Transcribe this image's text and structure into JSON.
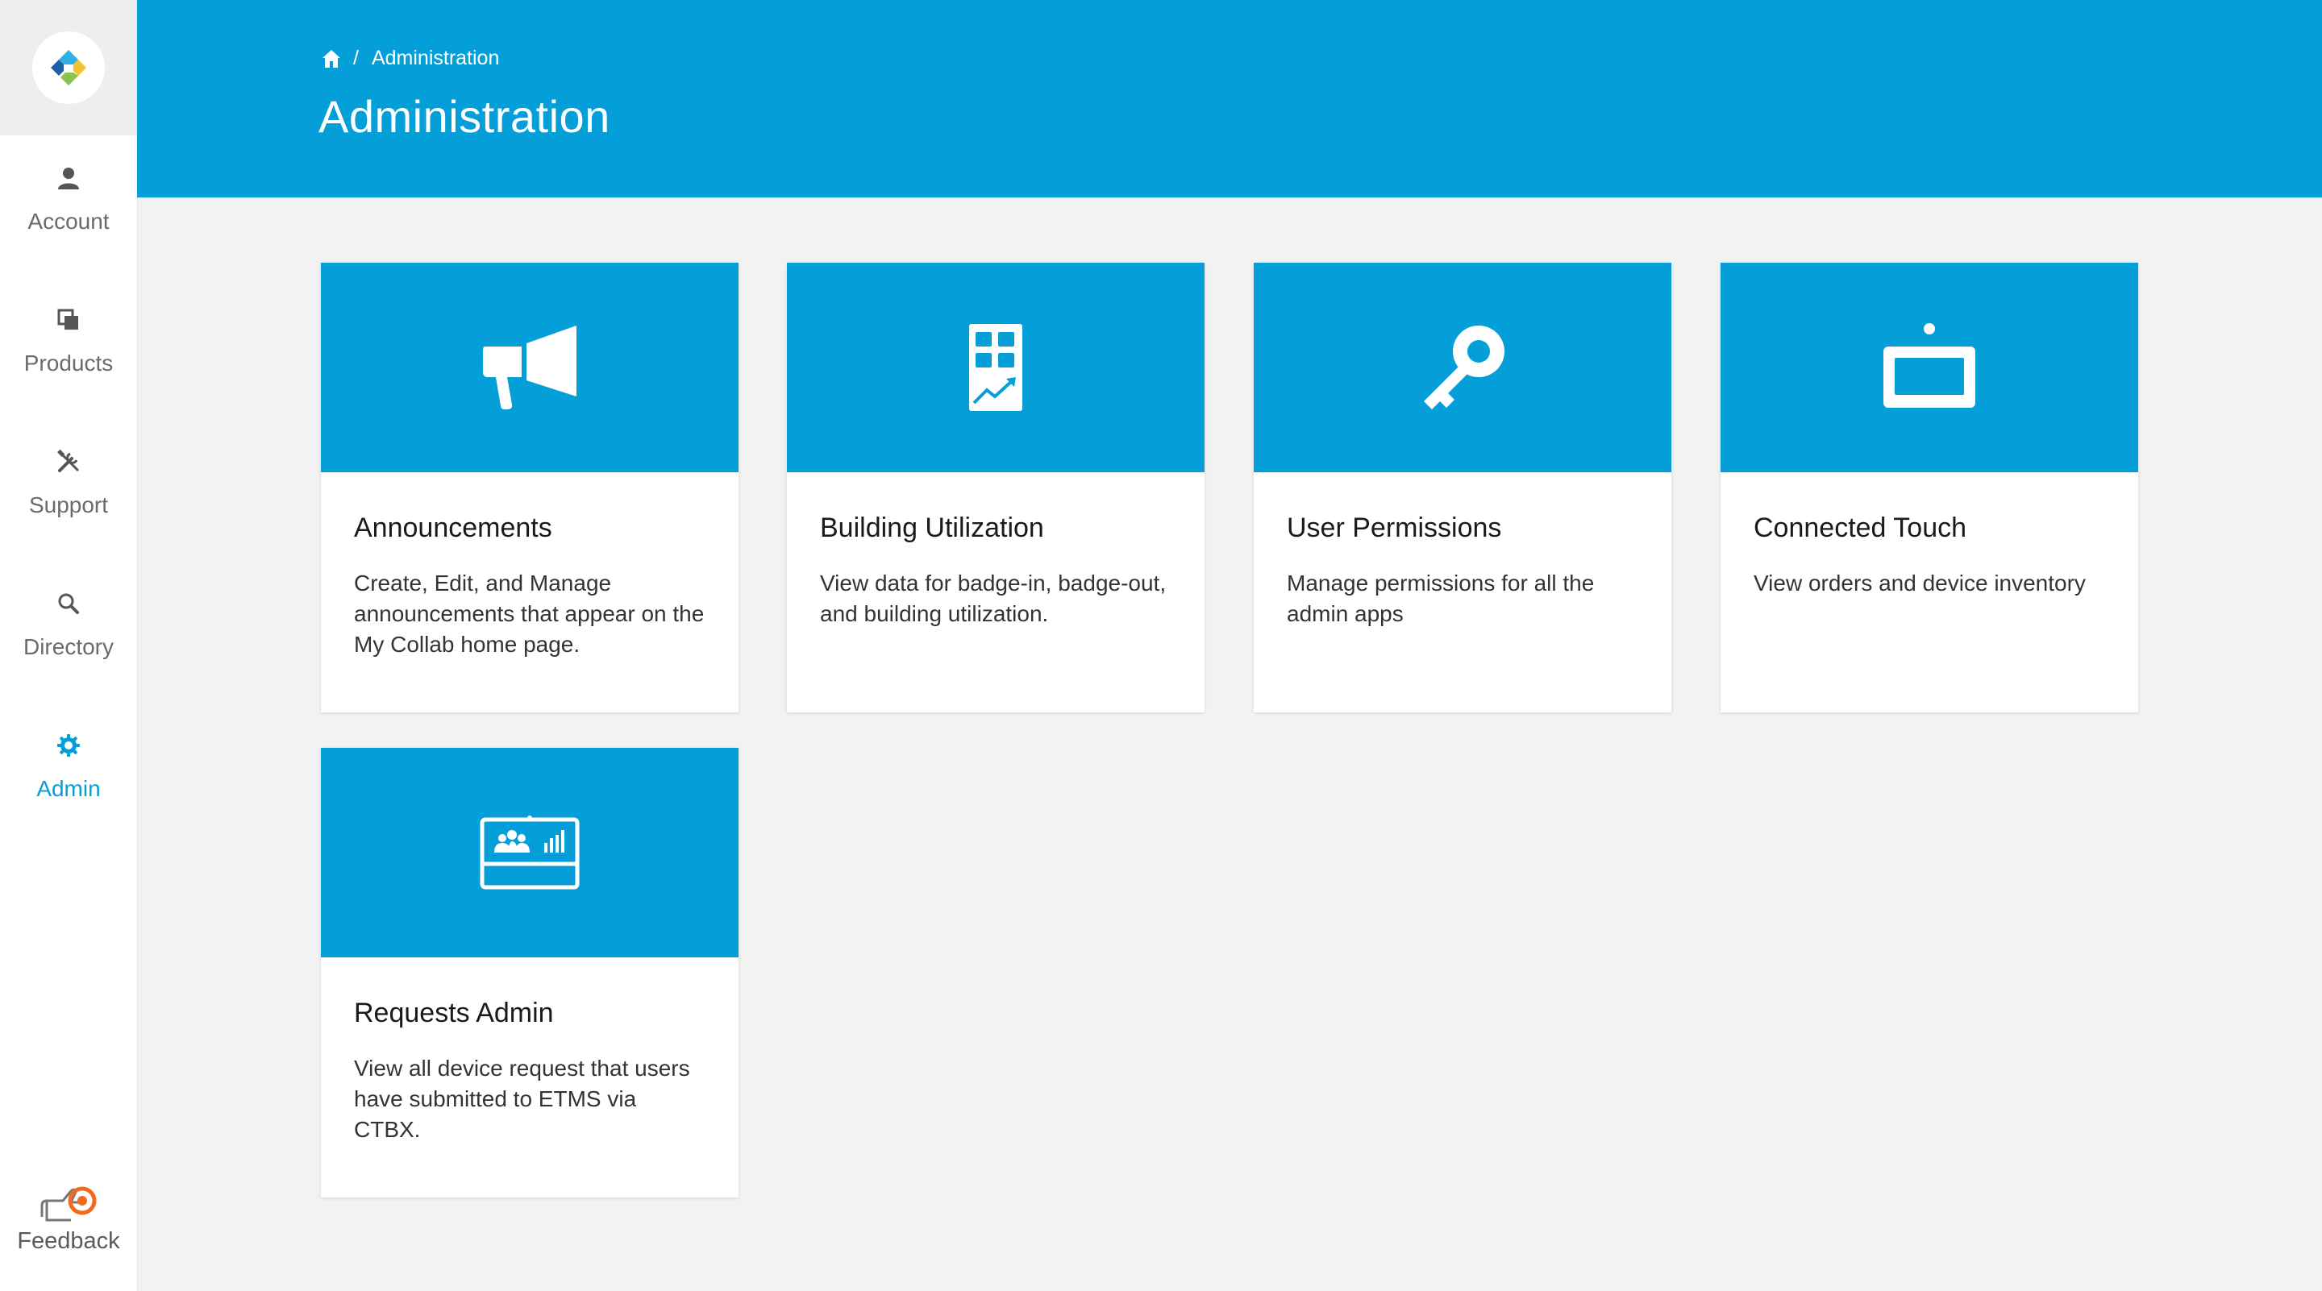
{
  "sidebar": {
    "items": [
      {
        "label": "Account",
        "icon": "person-icon"
      },
      {
        "label": "Products",
        "icon": "products-icon"
      },
      {
        "label": "Support",
        "icon": "tools-icon"
      },
      {
        "label": "Directory",
        "icon": "search-icon"
      },
      {
        "label": "Admin",
        "icon": "gear-icon",
        "active": true
      }
    ],
    "feedback_label": "Feedback"
  },
  "header": {
    "breadcrumb": {
      "separator": "/",
      "current": "Administration"
    },
    "title": "Administration"
  },
  "cards": [
    {
      "title": "Announcements",
      "description": "Create, Edit, and Manage announcements that appear on the My Collab home page.",
      "icon": "megaphone-icon"
    },
    {
      "title": "Building Utilization",
      "description": "View data for badge-in, badge-out, and building utilization.",
      "icon": "building-chart-icon"
    },
    {
      "title": "User Permissions",
      "description": "Manage permissions for all the admin apps",
      "icon": "key-icon"
    },
    {
      "title": "Connected Touch",
      "description": "View orders and device inventory",
      "icon": "touch-device-icon"
    },
    {
      "title": "Requests Admin",
      "description": "View all device request that users have submitted to ETMS via CTBX.",
      "icon": "dashboard-screen-icon"
    }
  ],
  "colors": {
    "accent": "#049fd9",
    "background": "#f2f2f2",
    "feedback_accent": "#f26b1d"
  }
}
